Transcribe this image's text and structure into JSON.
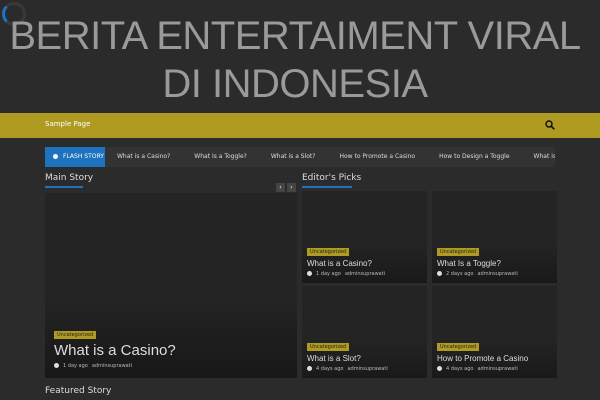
{
  "site": {
    "title": "BERITA ENTERTAIMENT VIRAL DI INDONESIA"
  },
  "nav": {
    "items": [
      "Sample Page"
    ]
  },
  "ticker": {
    "badge": "FLASH STORY",
    "items": [
      "What is a Casino?",
      "What Is a Toggle?",
      "What is a Slot?",
      "How to Promote a Casino",
      "How to Design a Toggle",
      "What is a Casino?",
      "Wh"
    ]
  },
  "main_story": {
    "heading": "Main Story",
    "post": {
      "category": "Uncategorized",
      "title": "What is a Casino?",
      "date": "1 day ago",
      "author": "adminsuprawati"
    }
  },
  "editors_picks": {
    "heading": "Editor's Picks",
    "posts": [
      {
        "category": "Uncategorized",
        "title": "What is a Casino?",
        "date": "1 day ago",
        "author": "adminsuprawati"
      },
      {
        "category": "Uncategorized",
        "title": "What Is a Toggle?",
        "date": "2 days ago",
        "author": "adminsuprawati"
      },
      {
        "category": "Uncategorized",
        "title": "What is a Slot?",
        "date": "4 days ago",
        "author": "adminsuprawati"
      },
      {
        "category": "Uncategorized",
        "title": "How to Promote a Casino",
        "date": "4 days ago",
        "author": "adminsuprawati"
      }
    ]
  },
  "featured": {
    "heading": "Featured Story"
  },
  "colors": {
    "accent_blue": "#1e73be",
    "accent_gold": "#b09b22",
    "background": "#2b2b2b"
  }
}
